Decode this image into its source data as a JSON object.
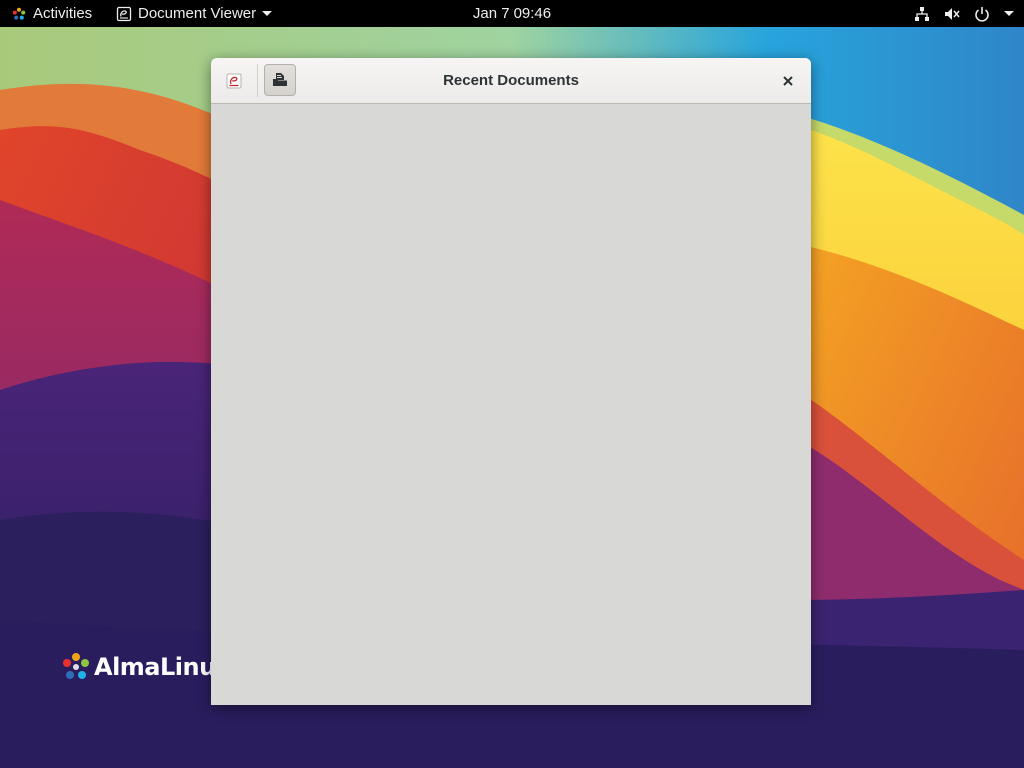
{
  "topbar": {
    "activities_label": "Activities",
    "app_menu_label": "Document Viewer",
    "clock_date": "Jan 7",
    "clock_time": "09:46",
    "icons": [
      "network-wired-icon",
      "volume-muted-icon",
      "power-icon",
      "system-menu-caret-icon"
    ]
  },
  "window": {
    "title": "Recent Documents",
    "app_icon": "document-viewer-icon",
    "open_button_icon": "open-document-icon",
    "close_icon": "close-icon"
  },
  "desktop": {
    "brand_wordmark": "AlmaLinux",
    "colors": {
      "topbar_bg": "#000000",
      "window_content_bg": "#d8d8d7",
      "headerbar_bg": "#f1f0ee"
    }
  }
}
